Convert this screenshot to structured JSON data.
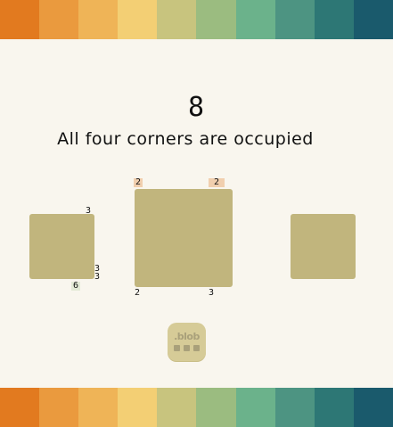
{
  "palette": [
    "#e27a1f",
    "#ea9a3e",
    "#efb457",
    "#f3cf74",
    "#c8c47e",
    "#9bbc80",
    "#6bb28b",
    "#4d9482",
    "#2d7775",
    "#1a5a6c"
  ],
  "level": {
    "number": "8",
    "hint": "All four corners are occupied"
  },
  "tiles": {
    "left": {
      "top_right": "3",
      "bottom_right_a": "3",
      "bottom_right_b": "3",
      "bottom_left": "6"
    },
    "center": {
      "top_left": "2",
      "top_right": "2",
      "bottom_left": "2",
      "bottom_right": "3"
    }
  },
  "logo": {
    "text": ".blob"
  }
}
